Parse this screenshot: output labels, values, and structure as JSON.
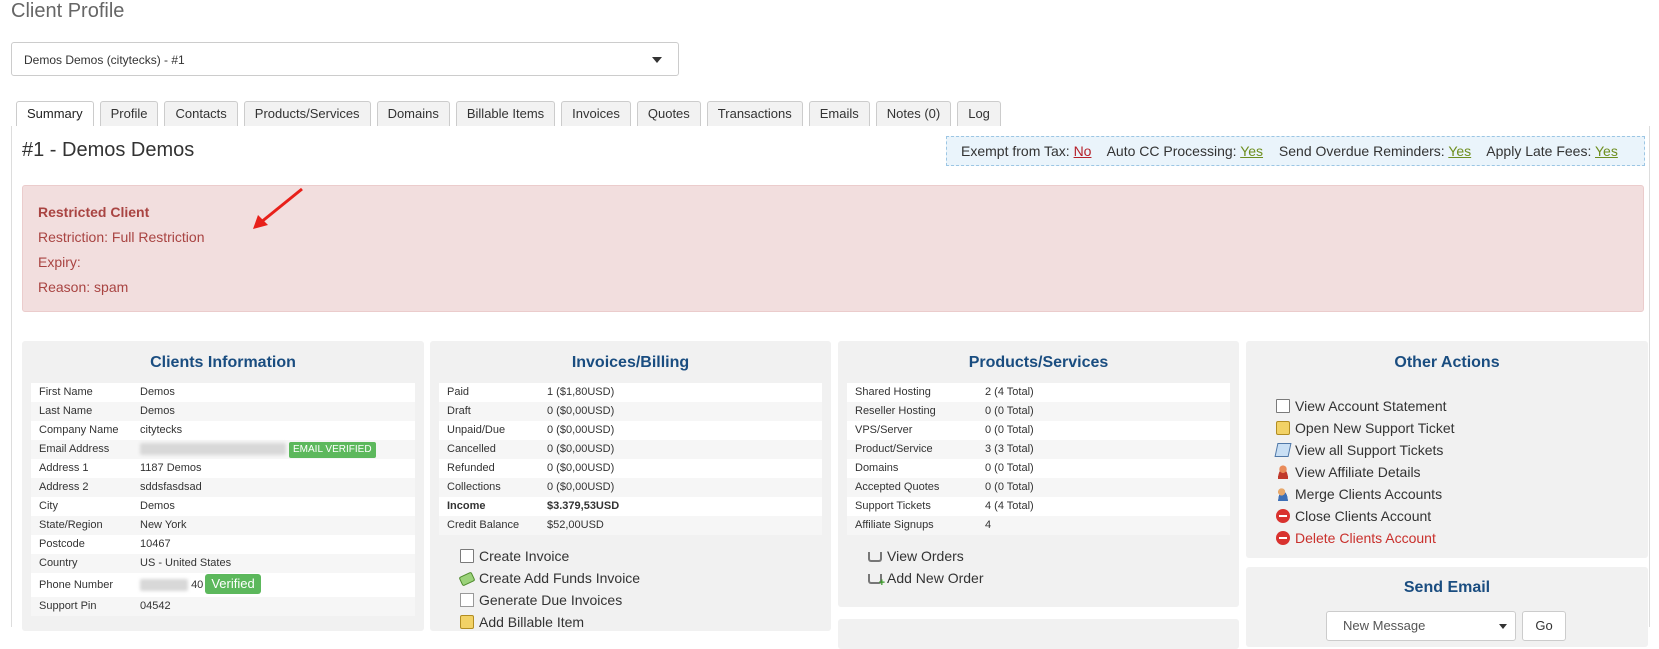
{
  "page_title": "Client Profile",
  "client_select": {
    "value": "Demos Demos (citytecks) - #1"
  },
  "tabs": [
    {
      "label": "Summary",
      "active": true
    },
    {
      "label": "Profile"
    },
    {
      "label": "Contacts"
    },
    {
      "label": "Products/Services"
    },
    {
      "label": "Domains"
    },
    {
      "label": "Billable Items"
    },
    {
      "label": "Invoices"
    },
    {
      "label": "Quotes"
    },
    {
      "label": "Transactions"
    },
    {
      "label": "Emails"
    },
    {
      "label": "Notes (0)"
    },
    {
      "label": "Log"
    }
  ],
  "client_heading": "#1 - Demos Demos",
  "flags": {
    "exempt_label": "Exempt from Tax:",
    "exempt_value": "No",
    "autocc_label": "Auto CC Processing:",
    "autocc_value": "Yes",
    "overdue_label": "Send Overdue Reminders:",
    "overdue_value": "Yes",
    "latefees_label": "Apply Late Fees:",
    "latefees_value": "Yes"
  },
  "restriction": {
    "title": "Restricted Client",
    "restriction": "Restriction: Full Restriction",
    "expiry": "Expiry:",
    "reason": "Reason: spam"
  },
  "clients_info": {
    "title": "Clients Information",
    "rows": [
      {
        "k": "First Name",
        "v": "Demos"
      },
      {
        "k": "Last Name",
        "v": "Demos"
      },
      {
        "k": "Company Name",
        "v": "citytecks"
      },
      {
        "k": "Email Address",
        "v": "",
        "badge": "EMAIL VERIFIED"
      },
      {
        "k": "Address 1",
        "v": "1187 Demos"
      },
      {
        "k": "Address 2",
        "v": "sddsfasdsad"
      },
      {
        "k": "City",
        "v": "Demos"
      },
      {
        "k": "State/Region",
        "v": "New York"
      },
      {
        "k": "Postcode",
        "v": "10467"
      },
      {
        "k": "Country",
        "v": "US - United States"
      },
      {
        "k": "Phone Number",
        "v": "40",
        "badge": "Verified"
      },
      {
        "k": "Support Pin",
        "v": "04542"
      }
    ]
  },
  "billing": {
    "title": "Invoices/Billing",
    "rows": [
      {
        "k": "Paid",
        "v": "1 ($1,80USD)"
      },
      {
        "k": "Draft",
        "v": "0 ($0,00USD)"
      },
      {
        "k": "Unpaid/Due",
        "v": "0 ($0,00USD)"
      },
      {
        "k": "Cancelled",
        "v": "0 ($0,00USD)"
      },
      {
        "k": "Refunded",
        "v": "0 ($0,00USD)"
      },
      {
        "k": "Collections",
        "v": "0 ($0,00USD)"
      },
      {
        "k": "Income",
        "v": "$3.379,53USD"
      },
      {
        "k": "Credit Balance",
        "v": "$52,00USD"
      }
    ],
    "actions": {
      "create_invoice": "Create Invoice",
      "create_add_funds": "Create Add Funds Invoice",
      "generate_due": "Generate Due Invoices",
      "add_billable": "Add Billable Item"
    }
  },
  "products": {
    "title": "Products/Services",
    "rows": [
      {
        "k": "Shared Hosting",
        "v": "2 (4 Total)"
      },
      {
        "k": "Reseller Hosting",
        "v": "0 (0 Total)"
      },
      {
        "k": "VPS/Server",
        "v": "0 (0 Total)"
      },
      {
        "k": "Product/Service",
        "v": "3 (3 Total)"
      },
      {
        "k": "Domains",
        "v": "0 (0 Total)"
      },
      {
        "k": "Accepted Quotes",
        "v": "0 (0 Total)"
      },
      {
        "k": "Support Tickets",
        "v": "4 (4 Total)"
      },
      {
        "k": "Affiliate Signups",
        "v": "4"
      }
    ],
    "actions": {
      "view_orders": "View Orders",
      "add_new_order": "Add New Order"
    }
  },
  "other_actions": {
    "title": "Other Actions",
    "view_statement": "View Account Statement",
    "open_ticket": "Open New Support Ticket",
    "view_tickets": "View all Support Tickets",
    "view_affiliate": "View Affiliate Details",
    "merge_accounts": "Merge Clients Accounts",
    "close_account": "Close Clients Account",
    "delete_account": "Delete Clients Account"
  },
  "send_email": {
    "title": "Send Email",
    "select_value": "New Message",
    "go_label": "Go"
  },
  "colors": {
    "heading_blue": "#1a4d80",
    "alert_red": "#a94442",
    "verified_green": "#5cb85c"
  }
}
